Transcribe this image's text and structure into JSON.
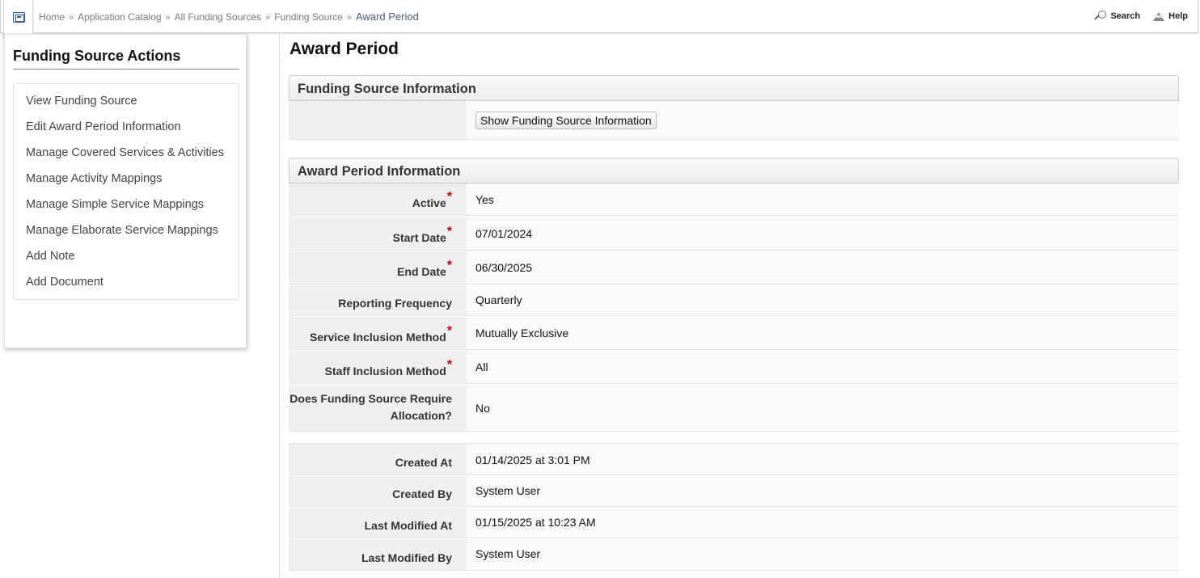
{
  "breadcrumb": {
    "items": [
      "Home",
      "Application Catalog",
      "All Funding Sources",
      "Funding Source"
    ],
    "separator": "»",
    "current": "Award Period"
  },
  "header": {
    "search_label": "Search",
    "help_label": "Help"
  },
  "sidebar": {
    "title": "Funding Source Actions",
    "items": [
      "View Funding Source",
      "Edit Award Period Information",
      "Manage Covered Services & Activities",
      "Manage Activity Mappings",
      "Manage Simple Service Mappings",
      "Manage Elaborate Service Mappings",
      "Add Note",
      "Add Document"
    ]
  },
  "main": {
    "title": "Award Period",
    "funding_section": {
      "title": "Funding Source Information",
      "show_button": "Show Funding Source Information"
    },
    "award_section": {
      "title": "Award Period Information",
      "required_marker": "*",
      "fields": {
        "active": {
          "label": "Active",
          "value": "Yes"
        },
        "start_date": {
          "label": "Start Date",
          "value": "07/01/2024"
        },
        "end_date": {
          "label": "End Date",
          "value": "06/30/2025"
        },
        "reporting_frequency": {
          "label": "Reporting Frequency",
          "value": "Quarterly"
        },
        "service_inclusion": {
          "label": "Service Inclusion Method",
          "value": "Mutually Exclusive"
        },
        "staff_inclusion": {
          "label": "Staff Inclusion Method",
          "value": "All"
        },
        "allocation": {
          "label_line1": "Does Funding Source Require",
          "label_line2": "Allocation?",
          "value": "No"
        }
      }
    },
    "audit": {
      "created_at": {
        "label": "Created At",
        "value": "01/14/2025 at 3:01 PM"
      },
      "created_by": {
        "label": "Created By",
        "value": "System User"
      },
      "modified_at": {
        "label": "Last Modified At",
        "value": "01/15/2025 at 10:23 AM"
      },
      "modified_by": {
        "label": "Last Modified By",
        "value": "System User"
      }
    }
  }
}
